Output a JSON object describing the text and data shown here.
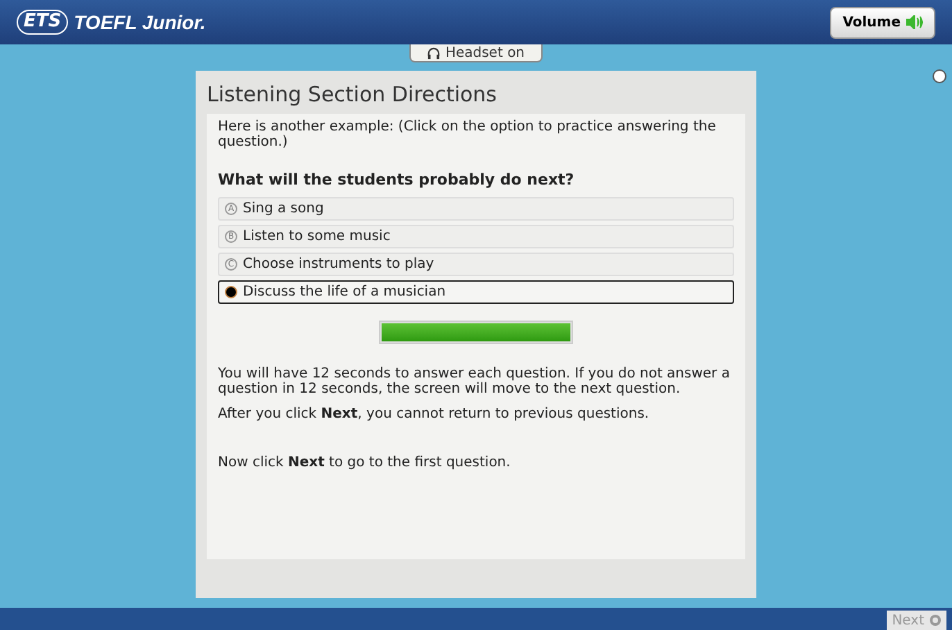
{
  "header": {
    "logo_mark": "ETS",
    "product": "TOEFL Junior.",
    "volume_button": "Volume"
  },
  "headset_tab": "Headset on",
  "panel": {
    "title": "Listening Section Directions",
    "intro": "Here is another example: (Click on the option to practice answering the question.)",
    "question": "What will the students probably do next?",
    "options": [
      {
        "letter": "A",
        "label": "Sing a song",
        "selected": false
      },
      {
        "letter": "B",
        "label": "Listen to some music",
        "selected": false
      },
      {
        "letter": "C",
        "label": "Choose instruments to play",
        "selected": false
      },
      {
        "label": "Discuss the life of a musician",
        "selected": true
      }
    ],
    "progress": {
      "level": 1
    },
    "paragraphs": [
      "You will have 12 seconds to answer each question. If you do not answer a question in 12 seconds, the screen will move to the next question.",
      "After you click **Next**, you cannot return to previous questions.",
      "Now click **Next** to go to the first question."
    ]
  },
  "footer": {
    "next_button": {
      "label": "Next",
      "disabled": true
    }
  }
}
